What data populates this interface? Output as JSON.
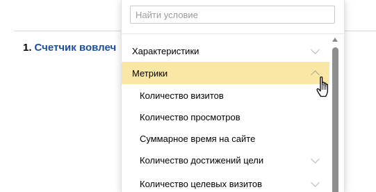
{
  "background_list": {
    "number": "1.",
    "link_text": "Счетчик вовлеч"
  },
  "dropdown": {
    "search_placeholder": "Найти условие",
    "items": [
      {
        "label": "Характеристики",
        "level": 0,
        "expanded": false,
        "has_chevron": true
      },
      {
        "label": "Метрики",
        "level": 0,
        "expanded": true,
        "has_chevron": true,
        "highlighted": true
      },
      {
        "label": "Количество визитов",
        "level": 1,
        "has_chevron": false
      },
      {
        "label": "Количество просмотров",
        "level": 1,
        "has_chevron": false
      },
      {
        "label": "Суммарное время на сайте",
        "level": 1,
        "has_chevron": false
      },
      {
        "label": "Количество достижений цели",
        "level": 1,
        "has_chevron": true
      },
      {
        "label": "Количество целевых визитов",
        "level": 1,
        "has_chevron": true
      }
    ]
  },
  "colors": {
    "highlight": "#fae6a5",
    "link": "#1a4fa0",
    "scrollbar": "#8f8f8f"
  },
  "cursor": "hand-pointer-icon"
}
